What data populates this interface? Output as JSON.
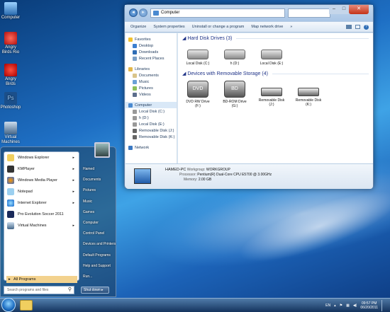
{
  "desktop": {
    "icons": [
      "Computer",
      "Angry Birds Rio",
      "Angry Birds",
      "Photoshop",
      "Virtual Machines"
    ]
  },
  "explorer": {
    "address": "Computer",
    "commands": [
      "Organize",
      "System properties",
      "Uninstall or change a program",
      "Map network drive",
      "»"
    ],
    "nav": {
      "favorites": "Favorites",
      "fav_items": [
        "Desktop",
        "Downloads",
        "Recent Places"
      ],
      "libraries": "Libraries",
      "lib_items": [
        "Documents",
        "Music",
        "Pictures",
        "Videos"
      ],
      "computer": "Computer",
      "comp_items": [
        "Local Disk (C:)",
        "h (D:)",
        "Local Disk (E:)",
        "Removable Disk (J:)",
        "Removable Disk (K:)"
      ],
      "network": "Network"
    },
    "hdd_header": "Hard Disk Drives (3)",
    "hdds": [
      "Local Disk (C:)",
      "h (D:)",
      "Local Disk (E:)"
    ],
    "removable_header": "Devices with Removable Storage (4)",
    "removables": [
      {
        "label": "DVD RW Drive\n(F:)",
        "badge": "DVD"
      },
      {
        "label": "BD-ROM Drive\n(G:)",
        "badge": "BD"
      },
      {
        "label": "Removable Disk\n(J:)",
        "badge": ""
      },
      {
        "label": "Removable Disk\n(K:)",
        "badge": ""
      }
    ],
    "details": {
      "name": "HAMED-PC",
      "workgroup_label": "Workgroup:",
      "workgroup": "WORKGROUP",
      "processor_label": "Processor:",
      "processor": "Pentium(R) Dual-Core  CPU      E5700  @ 3.00GHz",
      "memory_label": "Memory:",
      "memory": "2.00 GB"
    }
  },
  "start_menu": {
    "programs": [
      "Windows Explorer",
      "KMPlayer",
      "Windows Media Player",
      "Notepad",
      "Internet Explorer",
      "Pro Evolution Soccer 2011",
      "Virtual Machines"
    ],
    "all_programs": "All Programs",
    "search_placeholder": "Search programs and files",
    "right": [
      "Hamed",
      "Documents",
      "Pictures",
      "Music",
      "Games",
      "Computer",
      "Control Panel",
      "Devices and Printers",
      "Default Programs",
      "Help and Support",
      "Run..."
    ],
    "shutdown": "Shut down"
  },
  "taskbar": {
    "lang": "EN",
    "time": "09:57 PM",
    "date": "06/20/2011"
  }
}
